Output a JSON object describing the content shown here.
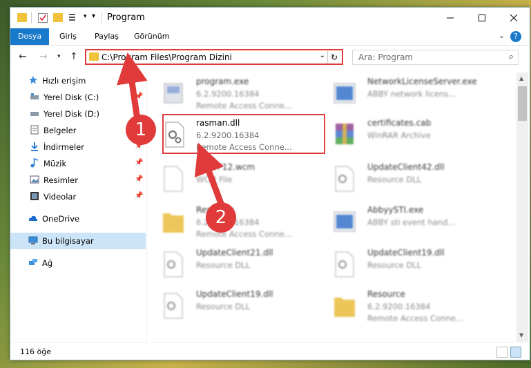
{
  "window": {
    "title": "Program",
    "minimize_icon": "minimize-icon",
    "maximize_icon": "maximize-icon",
    "close_icon": "close-icon"
  },
  "ribbon": {
    "tabs": [
      {
        "label": "Dosya",
        "active": true
      },
      {
        "label": "Giriş",
        "active": false
      },
      {
        "label": "Paylaş",
        "active": false
      },
      {
        "label": "Görünüm",
        "active": false
      }
    ],
    "help": "?"
  },
  "navigation": {
    "path": "C:\\Program Files\\Program Dizini",
    "search_placeholder": "Ara: Program"
  },
  "sidebar": {
    "items": [
      {
        "label": "Hızlı erişim",
        "icon": "star-icon",
        "pinned": false
      },
      {
        "label": "Yerel Disk (C:)",
        "icon": "drive-icon",
        "pinned": true
      },
      {
        "label": "Yerel Disk (D:)",
        "icon": "drive-icon",
        "pinned": false
      },
      {
        "label": "Belgeler",
        "icon": "document-icon",
        "pinned": true
      },
      {
        "label": "İndirmeler",
        "icon": "download-icon",
        "pinned": true
      },
      {
        "label": "Müzik",
        "icon": "music-icon",
        "pinned": true
      },
      {
        "label": "Resimler",
        "icon": "image-icon",
        "pinned": true
      },
      {
        "label": "Videolar",
        "icon": "video-icon",
        "pinned": true
      },
      {
        "label": "OneDrive",
        "icon": "cloud-icon",
        "pinned": false
      },
      {
        "label": "Bu bilgisayar",
        "icon": "computer-icon",
        "pinned": false,
        "selected": true
      },
      {
        "label": "Ağ",
        "icon": "network-icon",
        "pinned": false
      }
    ]
  },
  "files": [
    {
      "name": "program.exe",
      "line2": "6.2.9200.16384",
      "line3": "Remote Access Conne...",
      "icon": "exe-icon"
    },
    {
      "name": "NetworkLicenseServer.exe",
      "line2": "ABBY network licens...",
      "line3": "",
      "icon": "app-window-icon"
    },
    {
      "name": "rasman.dll",
      "line2": "6.2.9200.16384",
      "line3": "Remote Access Conne...",
      "icon": "dll-gear-icon"
    },
    {
      "name": "certificates.cab",
      "line2": "WinRAR Archive",
      "line3": "",
      "icon": "archive-icon"
    },
    {
      "name": "...oWP12.wcm",
      "line2": "WCM File",
      "line3": "",
      "icon": "blank-file-icon"
    },
    {
      "name": "UpdateClient42.dll",
      "line2": "Resource DLL",
      "line3": "",
      "icon": "dll-gear-icon"
    },
    {
      "name": "Resource",
      "line2": "6.2.9200.16384",
      "line3": "Remote Access Conne...",
      "icon": "folder-icon"
    },
    {
      "name": "AbbyySTI.exe",
      "line2": "ABBY sti event hand...",
      "line3": "",
      "icon": "app-window-icon"
    },
    {
      "name": "UpdateClient21.dll",
      "line2": "Resource DLL",
      "line3": "",
      "icon": "dll-gear-icon"
    },
    {
      "name": "UpdateClient19.dll",
      "line2": "Resource DLL",
      "line3": "",
      "icon": "dll-gear-icon"
    },
    {
      "name": "UpdateClient19.dll",
      "line2": "Resource DLL",
      "line3": "",
      "icon": "dll-gear-icon"
    },
    {
      "name": "Resource",
      "line2": "6.2.9200.16384",
      "line3": "Remote Access Conne...",
      "icon": "folder-icon"
    }
  ],
  "status": {
    "count": "116 öğe"
  },
  "annotations": {
    "badge1": "1",
    "badge2": "2",
    "color": "#e03a3a"
  }
}
